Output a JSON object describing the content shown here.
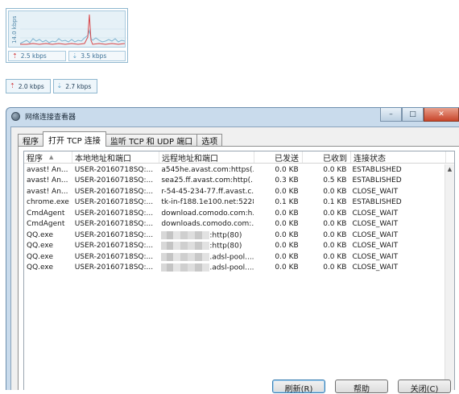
{
  "graph_widget": {
    "axis_label": "14.0 kbps",
    "upload": "2.5 kbps",
    "download": "3.5 kbps"
  },
  "mini_bar": {
    "upload": "2.0 kbps",
    "download": "2.7 kbps"
  },
  "window": {
    "title": "网络连接查看器",
    "controls": {
      "minimize": "–",
      "maximize": "□",
      "close": "✕"
    },
    "tabs": [
      {
        "label": "程序"
      },
      {
        "label": "打开 TCP 连接",
        "active": true
      },
      {
        "label": "监听 TCP 和 UDP 端口"
      },
      {
        "label": "选项"
      }
    ],
    "columns": [
      "程序",
      "本地地址和端口",
      "远程地址和端口",
      "已发送",
      "已收到",
      "连接状态"
    ],
    "rows": [
      {
        "program": "avast! An...",
        "local": "USER-20160718SQ:...",
        "remote": "a545he.avast.com:https(...",
        "sent": "0.0 KB",
        "received": "0.0 KB",
        "state": "ESTABLISHED"
      },
      {
        "program": "avast! An...",
        "local": "USER-20160718SQ:...",
        "remote": "sea25.ff.avast.com:http(...",
        "sent": "0.3 KB",
        "received": "0.5 KB",
        "state": "ESTABLISHED"
      },
      {
        "program": "avast! An...",
        "local": "USER-20160718SQ:...",
        "remote": "r-54-45-234-77.ff.avast.c...",
        "sent": "0.0 KB",
        "received": "0.0 KB",
        "state": "CLOSE_WAIT"
      },
      {
        "program": "chrome.exe",
        "local": "USER-20160718SQ:...",
        "remote": "tk-in-f188.1e100.net:5228",
        "sent": "0.1 KB",
        "received": "0.1 KB",
        "state": "ESTABLISHED"
      },
      {
        "program": "CmdAgent",
        "local": "USER-20160718SQ:...",
        "remote": "download.comodo.com:h...",
        "sent": "0.0 KB",
        "received": "0.0 KB",
        "state": "CLOSE_WAIT"
      },
      {
        "program": "CmdAgent",
        "local": "USER-20160718SQ:...",
        "remote": "downloads.comodo.com:...",
        "sent": "0.0 KB",
        "received": "0.0 KB",
        "state": "CLOSE_WAIT"
      },
      {
        "program": "QQ.exe",
        "local": "USER-20160718SQ:...",
        "remote": ":http(80)",
        "sent": "0.0 KB",
        "received": "0.0 KB",
        "state": "CLOSE_WAIT",
        "blurred": true
      },
      {
        "program": "QQ.exe",
        "local": "USER-20160718SQ:...",
        "remote": ":http(80)",
        "sent": "0.0 KB",
        "received": "0.0 KB",
        "state": "CLOSE_WAIT",
        "blurred": true
      },
      {
        "program": "QQ.exe",
        "local": "USER-20160718SQ:...",
        "remote": ".adsl-pool....",
        "sent": "0.0 KB",
        "received": "0.0 KB",
        "state": "CLOSE_WAIT",
        "blurred": true
      },
      {
        "program": "QQ.exe",
        "local": "USER-20160718SQ:...",
        "remote": ".adsl-pool....",
        "sent": "0.0 KB",
        "received": "0.0 KB",
        "state": "CLOSE_WAIT",
        "blurred": true
      }
    ],
    "buttons": {
      "refresh": "刷新(R)",
      "help": "帮助",
      "close": "关闭(C)"
    }
  }
}
